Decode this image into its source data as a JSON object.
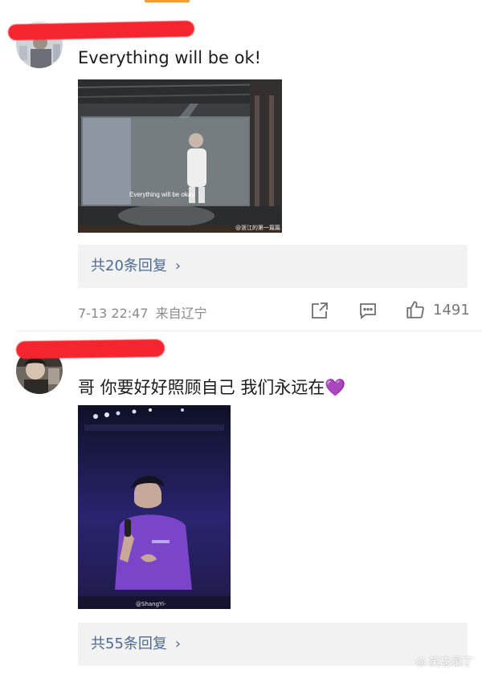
{
  "comments": [
    {
      "text": "Everything will be ok!",
      "photo_caption": "Everything will be okay",
      "photo_watermark": "@浙江的第一篇篇",
      "replies": "共20条回复",
      "time": "7-13 22:47",
      "source": "来自辽宁",
      "likes": "1491"
    },
    {
      "text": "哥 你要好好照顾自己 我们永远在💜",
      "photo_watermark": "@ShangYi-",
      "replies": "共55条回复"
    }
  ],
  "watermark": "笑忘录了",
  "colors": {
    "accent": "#f29b38",
    "reply_link": "#4e6a92",
    "redaction": "#f5252f",
    "muted": "#8a8a8a"
  },
  "icons": {
    "share": "share-icon",
    "comment": "comment-icon",
    "like": "thumbs-up-icon",
    "chevron": "chevron-right-icon"
  }
}
